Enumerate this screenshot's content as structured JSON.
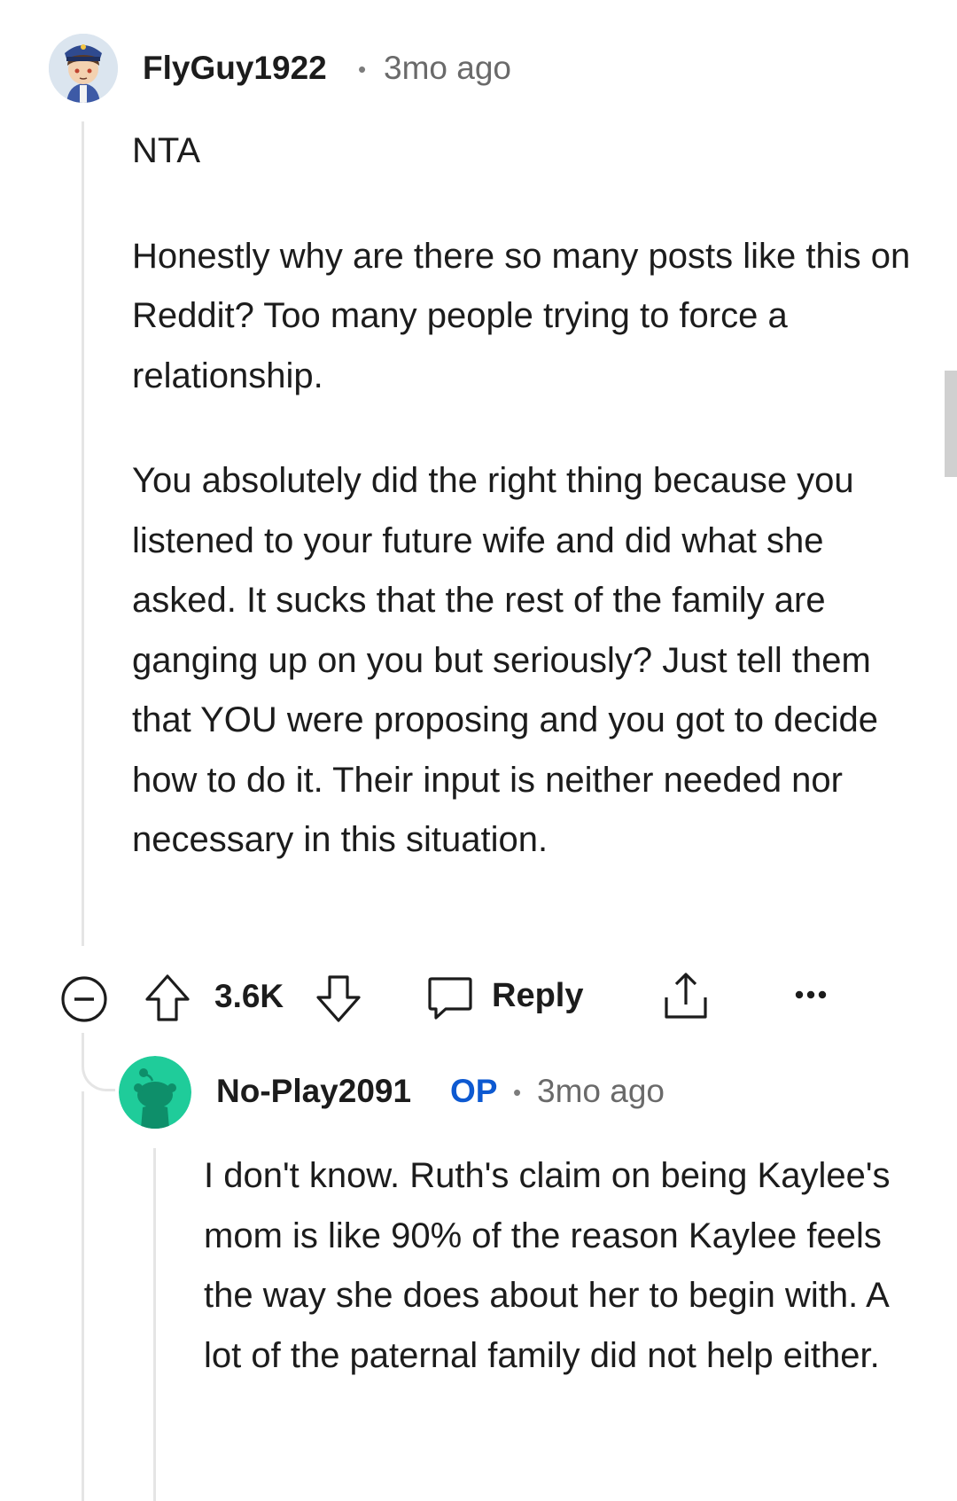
{
  "comment": {
    "username": "FlyGuy1922",
    "separator": "•",
    "time": "3mo ago",
    "paragraphs": [
      "NTA",
      "Honestly why are there so many posts like this on Reddit? Too many people trying to force a relationship.",
      "You absolutely did the right thing because you listened to your future wife and did what she asked. It sucks that the rest of the family are ganging up on you but seriously? Just tell them that YOU were proposing and you got to decide how to do it. Their input is neither needed nor necessary in this situation."
    ],
    "avatar_icon": "police-cap-character-avatar"
  },
  "actions": {
    "collapse_icon": "minus-circle-icon",
    "upvote_icon": "arrow-up-icon",
    "vote_count": "3.6K",
    "downvote_icon": "arrow-down-icon",
    "reply_icon": "speech-bubble-icon",
    "reply_label": "Reply",
    "share_icon": "share-icon",
    "more_icon": "more-dots-icon"
  },
  "reply": {
    "username": "No-Play2091",
    "badge": "OP",
    "separator": "•",
    "time": "3mo ago",
    "text": "I don't know. Ruth's claim on being Kaylee's mom is like 90% of the reason Kaylee feels the way she does about her to begin with. A lot of the paternal family did not help either.",
    "avatar_icon": "snoo-default-avatar",
    "avatar_color": "#1fcc9a"
  },
  "colors": {
    "text": "#1c1c1c",
    "meta": "#6a6a6a",
    "op_badge": "#0d59d1",
    "thread_line": "#e5e5e5"
  }
}
